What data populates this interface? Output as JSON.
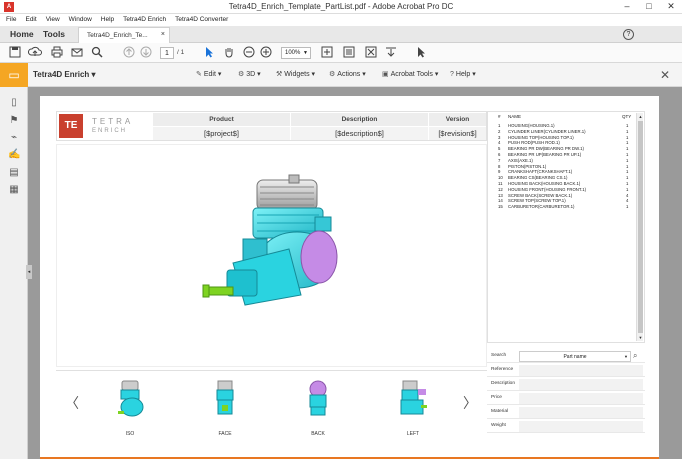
{
  "window": {
    "title": "Tetra4D_Enrich_Template_PartList.pdf - Adobe Acrobat Pro DC",
    "minimize": "–",
    "maximize": "□",
    "close": "✕"
  },
  "menu": [
    "File",
    "Edit",
    "View",
    "Window",
    "Help",
    "Tetra4D Enrich",
    "Tetra4D Converter"
  ],
  "tabs": {
    "home": "Home",
    "tools": "Tools",
    "doc": "Tetra4D_Enrich_Te...",
    "doc_close": "×",
    "help": "?"
  },
  "toolbar": {
    "page_current": "1",
    "page_total": "/ 1",
    "zoom": "100%"
  },
  "plugin": {
    "brand": "Tetra4D Enrich",
    "edit": "Edit",
    "3d": "3D",
    "widgets": "Widgets",
    "actions": "Actions",
    "acrobat_tools": "Acrobat Tools",
    "help": "Help"
  },
  "header": {
    "logo": "TE",
    "logo_line1": "TETRA",
    "logo_line2": "ENRICH",
    "col_product": "Product",
    "col_description": "Description",
    "col_version": "Version",
    "val_product": "[$project$]",
    "val_description": "[$description$]",
    "val_version": "[$revision$]"
  },
  "partlist": {
    "col_num": "#",
    "col_name": "NAME",
    "col_qty": "QTY",
    "rows": [
      {
        "n": "1",
        "name": "HOUSING(HOUSING.1)",
        "q": "1"
      },
      {
        "n": "2",
        "name": "CYLINDER LINER(CYLINDER LINER.1)",
        "q": "1"
      },
      {
        "n": "3",
        "name": "HOUSING TOP(HOUSING TOP.1)",
        "q": "1"
      },
      {
        "n": "4",
        "name": "PUSH ROD(PUSH ROD.1)",
        "q": "1"
      },
      {
        "n": "5",
        "name": "BEARING PR DW(BEARING PR DW.1)",
        "q": "1"
      },
      {
        "n": "6",
        "name": "BEARING PR UP(BEARING PR UP.1)",
        "q": "1"
      },
      {
        "n": "7",
        "name": "AXIS(AXE.1)",
        "q": "1"
      },
      {
        "n": "8",
        "name": "PISTON(PISTON.1)",
        "q": "1"
      },
      {
        "n": "9",
        "name": "CRANKSHAFT(CRANKSHAFT.1)",
        "q": "1"
      },
      {
        "n": "10",
        "name": "BEARING CS(BEARING CS.1)",
        "q": "1"
      },
      {
        "n": "11",
        "name": "HOUSING BACK(HOUSING BACK.1)",
        "q": "1"
      },
      {
        "n": "12",
        "name": "HOUSING FRONT(HOUSING FRONT.1)",
        "q": "1"
      },
      {
        "n": "13",
        "name": "SCREW BACK(SCREW BACK.1)",
        "q": "4"
      },
      {
        "n": "14",
        "name": "SCREW TOP(SCREW TOP.1)",
        "q": "4"
      },
      {
        "n": "15",
        "name": "CARBURETOR(CARBURETOR.1)",
        "q": "1"
      }
    ]
  },
  "props": {
    "search_label": "Search",
    "search_option": "Part name",
    "reference": "Reference",
    "description": "Description",
    "price": "Price",
    "material": "Material",
    "weight": "Weight"
  },
  "views": [
    "ISO",
    "FACE",
    "BACK",
    "LEFT"
  ],
  "colors": {
    "accent": "#e87722",
    "plugin_orange": "#f5a623",
    "logo_red": "#c9402e",
    "model_cyan": "#2ad3e0",
    "model_green": "#7ed321",
    "model_purple": "#c58be6"
  }
}
